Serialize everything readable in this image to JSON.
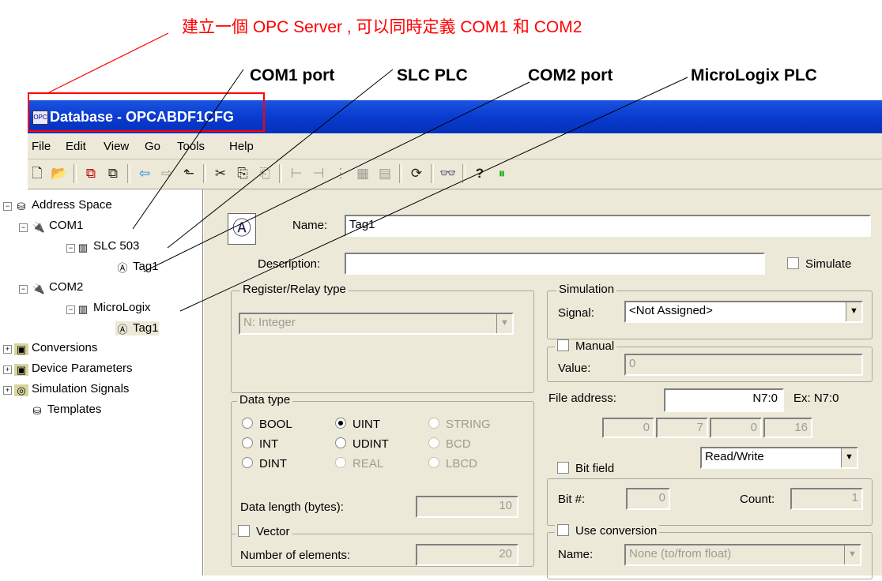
{
  "annotation": {
    "top_text": "建立一個 OPC Server , 可以同時定義 COM1 和 COM2",
    "callouts": [
      "COM1 port",
      "SLC PLC",
      "COM2 port",
      "MicroLogix PLC"
    ]
  },
  "window": {
    "title": "Database - OPCABDF1CFG",
    "icon": "opc-app-icon"
  },
  "menu": [
    "File",
    "Edit",
    "View",
    "Go",
    "Tools",
    "Help"
  ],
  "toolbar": {
    "glyphs": [
      "🗋",
      "📂",
      "⧉",
      "⧉",
      "⇦",
      "⇨",
      "⬑",
      "✂",
      "⎘",
      "⎗",
      "⊢",
      "⊣",
      "⋮",
      "▦",
      "▤",
      "⟳",
      "👓",
      "?",
      "⏸"
    ]
  },
  "tree": {
    "root": "Address Space",
    "com1": "COM1",
    "slc": "SLC 503",
    "tag_a": "Tag1",
    "com2": "COM2",
    "micrologix": "MicroLogix",
    "tag_b": "Tag1",
    "conversions": "Conversions",
    "device_params": "Device Parameters",
    "sim_signals": "Simulation Signals",
    "templates": "Templates"
  },
  "form": {
    "name_label": "Name:",
    "name_value": "Tag1",
    "description_label": "Description:",
    "description_value": "",
    "simulate_label": "Simulate",
    "register_group": "Register/Relay type",
    "register_value": "N: Integer",
    "simulation_group": "Simulation",
    "signal_label": "Signal:",
    "signal_value": "<Not Assigned>",
    "manual_label": "Manual",
    "value_label": "Value:",
    "value_value": "0",
    "data_type_group": "Data type",
    "types": {
      "bool": "BOOL",
      "uint": "UINT",
      "string": "STRING",
      "int": "INT",
      "udint": "UDINT",
      "bcd": "BCD",
      "dint": "DINT",
      "real": "REAL",
      "lbcd": "LBCD"
    },
    "file_address_label": "File address:",
    "file_address_value": "N7:0",
    "example": "Ex: N7:0",
    "addr_parts": [
      "0",
      "7",
      "0",
      "16"
    ],
    "access_value": "Read/Write",
    "data_length_label": "Data length (bytes):",
    "data_length_value": "10",
    "vector_label": "Vector",
    "num_elements_label": "Number of elements:",
    "num_elements_value": "20",
    "bit_field_label": "Bit field",
    "bit_num_label": "Bit #:",
    "bit_num_value": "0",
    "count_label": "Count:",
    "count_value": "1",
    "use_conversion_label": "Use conversion",
    "conv_name_label": "Name:",
    "conv_name_value": "None (to/from float)"
  }
}
